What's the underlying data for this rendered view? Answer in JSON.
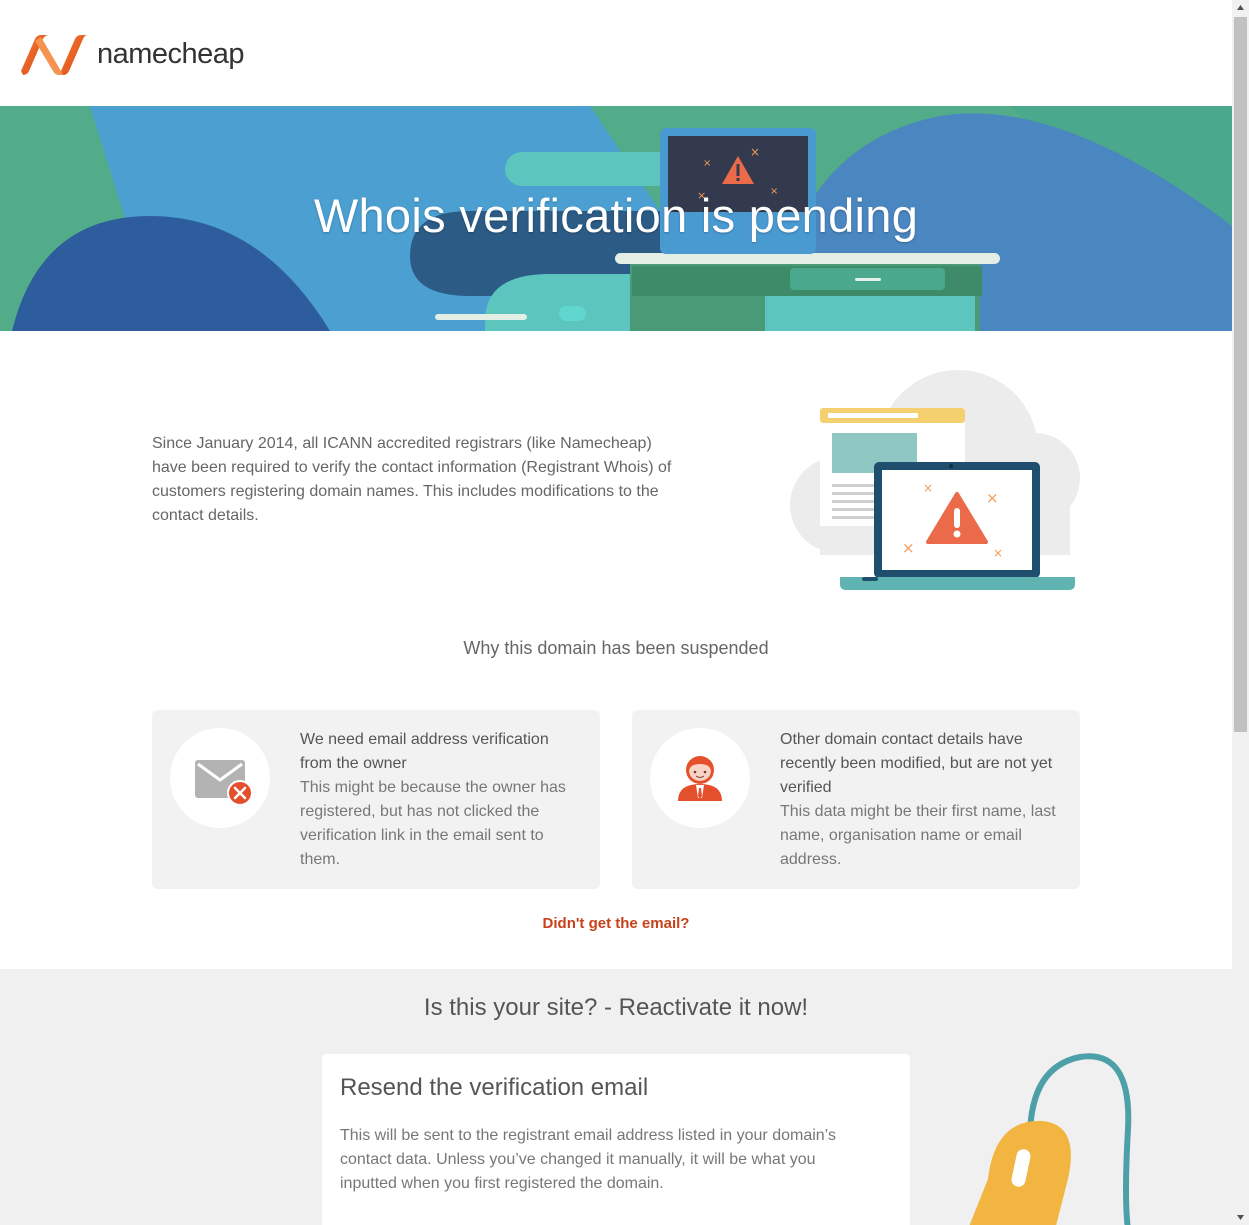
{
  "header": {
    "brand": "namecheap",
    "brand_color": "#e95d24"
  },
  "hero": {
    "title": "Whois verification is pending"
  },
  "intro": {
    "text": "Since January 2014, all ICANN accredited registrars (like Namecheap) have been required to verify the contact information (Registrant Whois) of customers registering domain names. This includes modifications to the contact details."
  },
  "why": {
    "title": "Why this domain has been suspended",
    "cards": [
      {
        "icon": "email-error-icon",
        "heading": "We need email address verification from the owner",
        "body": "This might be because the owner has registered, but has not clicked the verification link in the email sent to them."
      },
      {
        "icon": "person-icon",
        "heading": "Other domain contact details have recently been modified, but are not yet verified",
        "body": "This data might be their first name, last name, organisation name or email address."
      }
    ],
    "link": "Didn't get the email?",
    "link_color": "#c8411b"
  },
  "reactivate": {
    "title": "Is this your site? - Reactivate it now!",
    "resend_title": "Resend the verification email",
    "resend_desc": "This will be sent to the registrant email address listed in your domain’s contact data. Unless you’ve changed it manually, it will be what you inputted when you first registered the domain."
  }
}
